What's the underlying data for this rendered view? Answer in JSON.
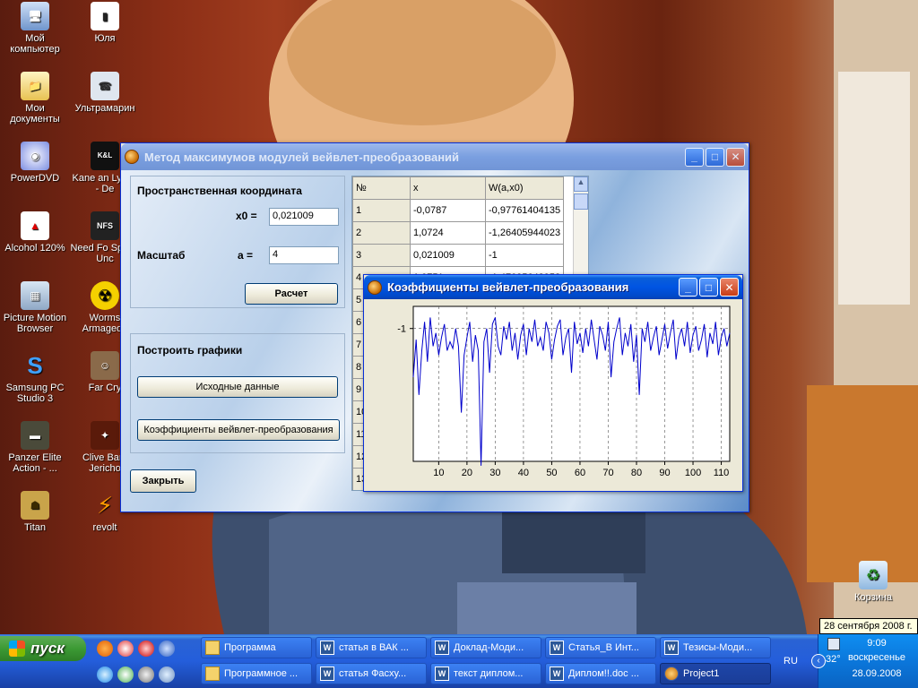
{
  "desktop": {
    "icons": [
      {
        "label": "Мой компьютер",
        "icon": "computer-icon"
      },
      {
        "label": "Мои документы",
        "icon": "documents-icon"
      },
      {
        "label": "PowerDVD",
        "icon": "dvd-icon"
      },
      {
        "label": "Alcohol 120%",
        "icon": "alcohol-icon"
      },
      {
        "label": "Picture Motion Browser",
        "icon": "photo-icon"
      },
      {
        "label": "Samsung PC Studio 3",
        "icon": "samsung-icon"
      },
      {
        "label": "Panzer Elite Action - ...",
        "icon": "tank-icon"
      },
      {
        "label": "Titan",
        "icon": "titan-icon"
      },
      {
        "label": "Юля",
        "icon": "user-icon"
      },
      {
        "label": "Ультрамарин",
        "icon": "network-icon"
      },
      {
        "label": "Kane an Lynch - De",
        "icon": "game-icon"
      },
      {
        "label": "Need Fo Speed Unc",
        "icon": "nfs-icon"
      },
      {
        "label": "Worms Armagedd",
        "icon": "radiation-icon"
      },
      {
        "label": "Far Cry",
        "icon": "farcry-icon"
      },
      {
        "label": "Clive Bark Jericho",
        "icon": "jericho-icon"
      },
      {
        "label": "revolt",
        "icon": "lightning-icon"
      },
      {
        "label": "Корзина",
        "icon": "recycle-bin-icon"
      }
    ],
    "date_tooltip": "28 сентября 2008 г."
  },
  "main_window": {
    "title": "Метод максимумов модулей вейвлет-преобразований",
    "group1_title": "Пространственная координата",
    "x0_label": "x0  =",
    "x0_value": "0,021009",
    "scale_label": "Масштаб",
    "a_label": "a  =",
    "a_value": "4",
    "calc_button": "Расчет",
    "group2_title": "Построить графики",
    "source_button": "Исходные данные",
    "coef_button": "Коэффициенты вейвлет-преобразования",
    "close_button": "Закрыть",
    "grid": {
      "headers": [
        "№",
        "x",
        "W(a,x0)"
      ],
      "rows": [
        [
          "1",
          "-0,0787",
          "-0,97761404135"
        ],
        [
          "2",
          "1,0724",
          "-1,26405944023"
        ],
        [
          "3",
          "0,021009",
          "-1"
        ],
        [
          "4",
          "1,0751",
          "-1,47095643958"
        ],
        [
          "5",
          "",
          ""
        ],
        [
          "6",
          "",
          ""
        ],
        [
          "7",
          "",
          ""
        ],
        [
          "8",
          "",
          ""
        ],
        [
          "9",
          "",
          ""
        ],
        [
          "10",
          "",
          ""
        ],
        [
          "11",
          "",
          ""
        ],
        [
          "12",
          "",
          ""
        ],
        [
          "13",
          "",
          ""
        ]
      ]
    }
  },
  "chart_window": {
    "title": "Коэффициенты вейвлет-преобразования"
  },
  "chart_data": {
    "type": "line",
    "title": "",
    "xlabel": "",
    "ylabel": "",
    "xlim": [
      1,
      113
    ],
    "ylim": [
      -1.6,
      -0.9
    ],
    "x_ticks": [
      "10",
      "20",
      "30",
      "40",
      "50",
      "60",
      "70",
      "80",
      "90",
      "100",
      "110"
    ],
    "y_ticks": [
      "-1"
    ],
    "grid": "vertical dashed at x ticks, horizontal dashed at y=-1",
    "series": [
      {
        "color": "#0000cc",
        "x": [
          1,
          2,
          3,
          4,
          5,
          6,
          7,
          8,
          9,
          10,
          11,
          12,
          13,
          14,
          15,
          16,
          17,
          18,
          19,
          20,
          21,
          22,
          23,
          24,
          25,
          26,
          27,
          28,
          29,
          30,
          31,
          32,
          33,
          34,
          35,
          36,
          37,
          38,
          39,
          40,
          41,
          42,
          43,
          44,
          45,
          46,
          47,
          48,
          49,
          50,
          51,
          52,
          53,
          54,
          55,
          56,
          57,
          58,
          59,
          60,
          61,
          62,
          63,
          64,
          65,
          66,
          67,
          68,
          69,
          70,
          71,
          72,
          73,
          74,
          75,
          76,
          77,
          78,
          79,
          80,
          81,
          82,
          83,
          84,
          85,
          86,
          87,
          88,
          89,
          90,
          91,
          92,
          93,
          94,
          95,
          96,
          97,
          98,
          99,
          100,
          101,
          102,
          103,
          104,
          105,
          106,
          107,
          108,
          109,
          110,
          111,
          112,
          113
        ],
        "y": [
          -1.22,
          -1.05,
          -1.3,
          -1.1,
          -0.97,
          -1.15,
          -0.95,
          -1.08,
          -1.02,
          -1.12,
          -1.04,
          -0.98,
          -1.1,
          -1.06,
          -1.09,
          -1.0,
          -1.08,
          -1.38,
          -1.12,
          -1.04,
          -0.97,
          -1.15,
          -1.03,
          -1.1,
          -1.62,
          -1.06,
          -1.0,
          -1.2,
          -0.98,
          -0.95,
          -1.08,
          -1.12,
          -0.99,
          -1.05,
          -0.97,
          -1.1,
          -1.02,
          -1.14,
          -1.03,
          -0.98,
          -1.12,
          -1.0,
          -1.06,
          -0.96,
          -1.08,
          -1.04,
          -1.1,
          -0.97,
          -1.02,
          -1.14,
          -1.05,
          -0.99,
          -0.96,
          -1.12,
          -1.04,
          -1.0,
          -1.2,
          -0.97,
          -1.07,
          -1.02,
          -1.11,
          -1.0,
          -1.08,
          -0.96,
          -1.05,
          -1.14,
          -0.99,
          -1.03,
          -1.1,
          -0.97,
          -1.22,
          -1.06,
          -1.0,
          -0.95,
          -1.12,
          -1.02,
          -1.08,
          -0.98,
          -1.15,
          -1.03,
          -1.3,
          -1.0,
          -1.06,
          -0.97,
          -1.1,
          -1.04,
          -0.99,
          -1.12,
          -1.05,
          -0.98,
          -1.09,
          -1.02,
          -0.96,
          -1.14,
          -1.04,
          -1.0,
          -1.08,
          -0.97,
          -1.11,
          -1.03,
          -0.99,
          -1.1,
          -1.05,
          -0.98,
          -1.13,
          -1.02,
          -1.07,
          -0.97,
          -1.12,
          -1.04,
          -1.0,
          -1.08,
          -1.02
        ]
      }
    ]
  },
  "taskbar": {
    "start_label": "пуск",
    "row1": [
      {
        "label": "Программа",
        "icon": "folder"
      },
      {
        "label": "статья в ВАК ...",
        "icon": "word"
      },
      {
        "label": "Доклад-Моди...",
        "icon": "word"
      },
      {
        "label": "Статья_В Инт...",
        "icon": "word"
      },
      {
        "label": "Тезисы-Моди...",
        "icon": "word"
      }
    ],
    "row2": [
      {
        "label": "Программное ...",
        "icon": "folder"
      },
      {
        "label": "статья Фасху...",
        "icon": "word"
      },
      {
        "label": "текст диплом...",
        "icon": "word"
      },
      {
        "label": "Диплом!!.doc ...",
        "icon": "word"
      },
      {
        "label": "Project1",
        "icon": "app"
      }
    ],
    "lang": "RU",
    "temp": "32°",
    "time": "9:09",
    "day": "воскресенье",
    "date": "28.09.2008"
  }
}
